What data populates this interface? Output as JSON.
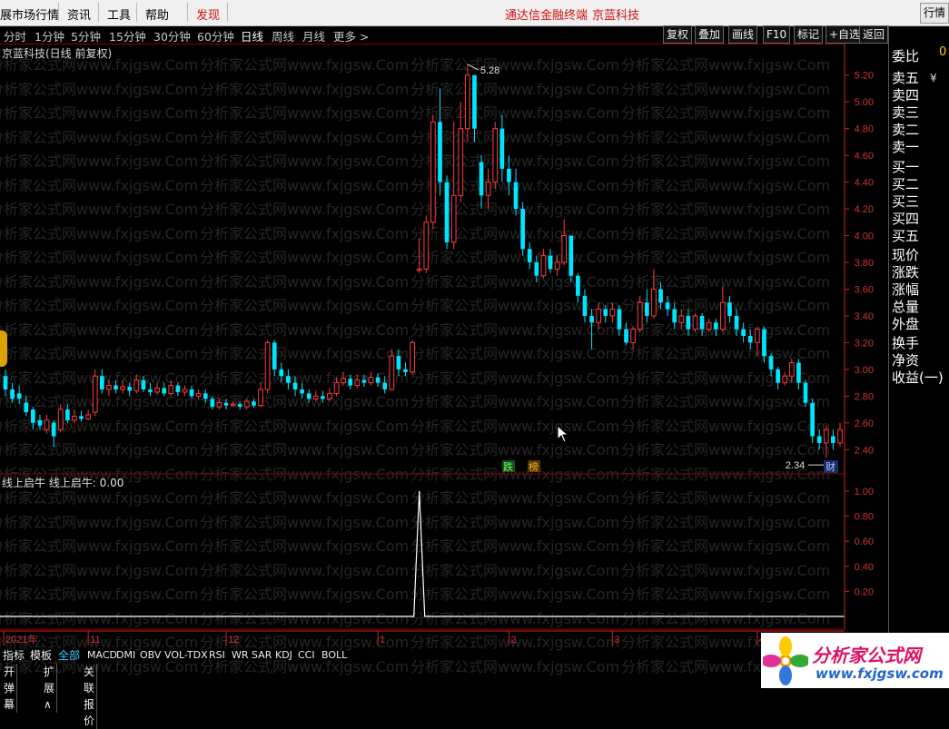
{
  "menubar": {
    "items": [
      "展市场行情",
      "资讯",
      "工具",
      "帮助",
      "发现"
    ],
    "center_title": "通达信金融终端",
    "stock_name": "京蓝科技",
    "right_button": "行情"
  },
  "toolbar": {
    "periods": [
      "分时",
      "1分钟",
      "5分钟",
      "15分钟",
      "30分钟",
      "60分钟",
      "日线",
      "周线",
      "月线",
      "更多 >"
    ],
    "active_period": "日线",
    "buttons": [
      "复权",
      "叠加",
      "画线",
      "F10",
      "标记",
      "+自选",
      "返回"
    ]
  },
  "main_chart": {
    "title": "京蓝科技(日线 前复权)",
    "high_label": "5.28",
    "low_label": "2.34",
    "y_ticks": [
      "5.20",
      "5.00",
      "4.80",
      "4.60",
      "4.40",
      "4.20",
      "4.00",
      "3.80",
      "3.60",
      "3.40",
      "3.20",
      "3.00",
      "2.80",
      "2.60",
      "2.40"
    ],
    "badges": [
      "跌",
      "榜"
    ],
    "fin_badge": "财"
  },
  "indicator": {
    "title": "线上启牛  线上启牛: 0.00",
    "y_ticks": [
      "1.00",
      "0.80",
      "0.60",
      "0.40",
      "0.20"
    ]
  },
  "time_axis": {
    "labels": [
      "2021年",
      "11",
      "12",
      "1",
      "2",
      "3",
      "4"
    ]
  },
  "right_panel": {
    "labels": [
      "委比",
      "卖五",
      "卖四",
      "卖三",
      "卖二",
      "卖一",
      "买一",
      "买二",
      "买三",
      "买四",
      "买五",
      "现价",
      "涨跌",
      "涨幅",
      "总量",
      "外盘",
      "换手",
      "净资",
      "收益(一)"
    ],
    "top_value": "0",
    "currency": "¥"
  },
  "bottom": {
    "tabs": [
      "指标",
      "模板",
      "全部",
      "MACD",
      "DMI",
      "OBV",
      "VOL-TDX",
      "RSI",
      "WR",
      "SAR",
      "KDJ",
      "CCI",
      "BOLL"
    ],
    "active_tab": "全部",
    "row2": [
      "开弹幕",
      "扩展∧",
      "关联报价"
    ]
  },
  "watermark": "分析家公式网www.fxjgsw.Com",
  "logo": {
    "text": "分析家公式网",
    "url": "www.fxjgsw.com"
  },
  "colors": {
    "up": "#ff3b3b",
    "down": "#00e5ff",
    "grid": "#8b0000",
    "axis": "#cc2222"
  },
  "chart_data": {
    "type": "candlestick",
    "title": "京蓝科技(日线 前复权)",
    "y_range": [
      2.3,
      5.3
    ],
    "candles": [
      {
        "o": 2.95,
        "c": 2.85,
        "h": 3.0,
        "l": 2.8
      },
      {
        "o": 2.85,
        "c": 2.78,
        "h": 2.9,
        "l": 2.75
      },
      {
        "o": 2.82,
        "c": 2.78,
        "h": 2.88,
        "l": 2.74
      },
      {
        "o": 2.75,
        "c": 2.68,
        "h": 2.8,
        "l": 2.65
      },
      {
        "o": 2.7,
        "c": 2.6,
        "h": 2.72,
        "l": 2.55
      },
      {
        "o": 2.62,
        "c": 2.58,
        "h": 2.66,
        "l": 2.55
      },
      {
        "o": 2.55,
        "c": 2.62,
        "h": 2.66,
        "l": 2.52
      },
      {
        "o": 2.6,
        "c": 2.5,
        "h": 2.62,
        "l": 2.42
      },
      {
        "o": 2.55,
        "c": 2.7,
        "h": 2.74,
        "l": 2.53
      },
      {
        "o": 2.7,
        "c": 2.62,
        "h": 2.74,
        "l": 2.6
      },
      {
        "o": 2.62,
        "c": 2.65,
        "h": 2.7,
        "l": 2.6
      },
      {
        "o": 2.65,
        "c": 2.63,
        "h": 2.69,
        "l": 2.61
      },
      {
        "o": 2.63,
        "c": 2.66,
        "h": 2.7,
        "l": 2.62
      },
      {
        "o": 2.68,
        "c": 2.95,
        "h": 3.0,
        "l": 2.65
      },
      {
        "o": 2.95,
        "c": 2.85,
        "h": 3.0,
        "l": 2.82
      },
      {
        "o": 2.85,
        "c": 2.88,
        "h": 2.92,
        "l": 2.8
      },
      {
        "o": 2.88,
        "c": 2.85,
        "h": 2.92,
        "l": 2.82
      },
      {
        "o": 2.85,
        "c": 2.87,
        "h": 2.92,
        "l": 2.82
      },
      {
        "o": 2.87,
        "c": 2.84,
        "h": 2.9,
        "l": 2.8
      },
      {
        "o": 2.84,
        "c": 2.92,
        "h": 2.96,
        "l": 2.82
      },
      {
        "o": 2.92,
        "c": 2.85,
        "h": 2.95,
        "l": 2.83
      },
      {
        "o": 2.85,
        "c": 2.83,
        "h": 2.9,
        "l": 2.8
      },
      {
        "o": 2.83,
        "c": 2.86,
        "h": 2.9,
        "l": 2.81
      },
      {
        "o": 2.86,
        "c": 2.82,
        "h": 2.9,
        "l": 2.8
      },
      {
        "o": 2.82,
        "c": 2.88,
        "h": 2.92,
        "l": 2.8
      },
      {
        "o": 2.88,
        "c": 2.83,
        "h": 2.9,
        "l": 2.8
      },
      {
        "o": 2.83,
        "c": 2.85,
        "h": 2.88,
        "l": 2.8
      },
      {
        "o": 2.85,
        "c": 2.8,
        "h": 2.88,
        "l": 2.78
      },
      {
        "o": 2.8,
        "c": 2.82,
        "h": 2.85,
        "l": 2.77
      },
      {
        "o": 2.82,
        "c": 2.78,
        "h": 2.85,
        "l": 2.75
      },
      {
        "o": 2.78,
        "c": 2.72,
        "h": 2.8,
        "l": 2.7
      },
      {
        "o": 2.72,
        "c": 2.75,
        "h": 2.78,
        "l": 2.7
      },
      {
        "o": 2.75,
        "c": 2.73,
        "h": 2.78,
        "l": 2.7
      },
      {
        "o": 2.73,
        "c": 2.74,
        "h": 2.76,
        "l": 2.72
      },
      {
        "o": 2.74,
        "c": 2.72,
        "h": 2.76,
        "l": 2.7
      },
      {
        "o": 2.72,
        "c": 2.76,
        "h": 2.78,
        "l": 2.7
      },
      {
        "o": 2.76,
        "c": 2.73,
        "h": 2.78,
        "l": 2.71
      },
      {
        "o": 2.73,
        "c": 2.85,
        "h": 2.9,
        "l": 2.72
      },
      {
        "o": 2.85,
        "c": 3.2,
        "h": 3.22,
        "l": 2.82
      },
      {
        "o": 3.2,
        "c": 3.0,
        "h": 3.22,
        "l": 2.95
      },
      {
        "o": 3.0,
        "c": 2.95,
        "h": 3.05,
        "l": 2.9
      },
      {
        "o": 2.95,
        "c": 2.9,
        "h": 3.0,
        "l": 2.85
      },
      {
        "o": 2.9,
        "c": 2.85,
        "h": 2.95,
        "l": 2.8
      },
      {
        "o": 2.85,
        "c": 2.82,
        "h": 2.9,
        "l": 2.78
      },
      {
        "o": 2.82,
        "c": 2.78,
        "h": 2.85,
        "l": 2.75
      },
      {
        "o": 2.78,
        "c": 2.8,
        "h": 2.84,
        "l": 2.76
      },
      {
        "o": 2.8,
        "c": 2.78,
        "h": 2.84,
        "l": 2.75
      },
      {
        "o": 2.78,
        "c": 2.82,
        "h": 2.86,
        "l": 2.76
      },
      {
        "o": 2.82,
        "c": 2.9,
        "h": 2.94,
        "l": 2.8
      },
      {
        "o": 2.9,
        "c": 2.93,
        "h": 2.98,
        "l": 2.88
      },
      {
        "o": 2.93,
        "c": 2.88,
        "h": 2.96,
        "l": 2.85
      },
      {
        "o": 2.88,
        "c": 2.92,
        "h": 2.96,
        "l": 2.86
      },
      {
        "o": 2.92,
        "c": 2.9,
        "h": 2.96,
        "l": 2.87
      },
      {
        "o": 2.9,
        "c": 2.94,
        "h": 2.98,
        "l": 2.88
      },
      {
        "o": 2.94,
        "c": 2.9,
        "h": 2.97,
        "l": 2.87
      },
      {
        "o": 2.9,
        "c": 2.85,
        "h": 2.95,
        "l": 2.82
      },
      {
        "o": 2.85,
        "c": 3.1,
        "h": 3.15,
        "l": 2.84
      },
      {
        "o": 3.1,
        "c": 3.0,
        "h": 3.15,
        "l": 2.95
      },
      {
        "o": 3.0,
        "c": 2.98,
        "h": 3.05,
        "l": 2.95
      },
      {
        "o": 2.98,
        "c": 3.2,
        "h": 3.22,
        "l": 2.96
      },
      {
        "o": 3.74,
        "c": 3.75,
        "h": 3.98,
        "l": 3.72
      },
      {
        "o": 3.75,
        "c": 4.1,
        "h": 4.15,
        "l": 3.72
      },
      {
        "o": 4.1,
        "c": 4.85,
        "h": 4.9,
        "l": 4.05
      },
      {
        "o": 4.85,
        "c": 4.4,
        "h": 5.1,
        "l": 4.3
      },
      {
        "o": 4.4,
        "c": 3.95,
        "h": 4.45,
        "l": 3.9
      },
      {
        "o": 3.95,
        "c": 4.3,
        "h": 4.85,
        "l": 3.9
      },
      {
        "o": 4.3,
        "c": 4.8,
        "h": 5.0,
        "l": 4.25
      },
      {
        "o": 4.8,
        "c": 5.2,
        "h": 5.28,
        "l": 4.7
      },
      {
        "o": 5.2,
        "c": 4.8,
        "h": 5.1,
        "l": 4.7
      },
      {
        "o": 4.55,
        "c": 4.3,
        "h": 4.6,
        "l": 4.2
      },
      {
        "o": 4.3,
        "c": 4.4,
        "h": 4.5,
        "l": 4.2
      },
      {
        "o": 4.4,
        "c": 4.8,
        "h": 4.85,
        "l": 4.35
      },
      {
        "o": 4.8,
        "c": 4.5,
        "h": 4.9,
        "l": 4.4
      },
      {
        "o": 4.5,
        "c": 4.4,
        "h": 4.6,
        "l": 4.3
      },
      {
        "o": 4.4,
        "c": 4.2,
        "h": 4.5,
        "l": 4.15
      },
      {
        "o": 4.2,
        "c": 3.9,
        "h": 4.25,
        "l": 3.85
      },
      {
        "o": 3.9,
        "c": 3.8,
        "h": 3.95,
        "l": 3.75
      },
      {
        "o": 3.8,
        "c": 3.7,
        "h": 3.85,
        "l": 3.65
      },
      {
        "o": 3.7,
        "c": 3.85,
        "h": 3.9,
        "l": 3.68
      },
      {
        "o": 3.85,
        "c": 3.75,
        "h": 3.9,
        "l": 3.72
      },
      {
        "o": 3.75,
        "c": 3.8,
        "h": 3.85,
        "l": 3.7
      },
      {
        "o": 3.8,
        "c": 4.0,
        "h": 4.12,
        "l": 3.78
      },
      {
        "o": 4.0,
        "c": 3.7,
        "h": 4.0,
        "l": 3.65
      },
      {
        "o": 3.7,
        "c": 3.55,
        "h": 3.72,
        "l": 3.5
      },
      {
        "o": 3.55,
        "c": 3.4,
        "h": 3.6,
        "l": 3.35
      },
      {
        "o": 3.4,
        "c": 3.35,
        "h": 3.45,
        "l": 3.15
      },
      {
        "o": 3.35,
        "c": 3.45,
        "h": 3.5,
        "l": 3.3
      },
      {
        "o": 3.45,
        "c": 3.4,
        "h": 3.48,
        "l": 3.35
      },
      {
        "o": 3.4,
        "c": 3.45,
        "h": 3.5,
        "l": 3.35
      },
      {
        "o": 3.45,
        "c": 3.3,
        "h": 3.48,
        "l": 3.25
      },
      {
        "o": 3.3,
        "c": 3.2,
        "h": 3.35,
        "l": 3.18
      },
      {
        "o": 3.2,
        "c": 3.3,
        "h": 3.32,
        "l": 3.15
      },
      {
        "o": 3.3,
        "c": 3.5,
        "h": 3.55,
        "l": 3.28
      },
      {
        "o": 3.5,
        "c": 3.4,
        "h": 3.6,
        "l": 3.35
      },
      {
        "o": 3.4,
        "c": 3.6,
        "h": 3.75,
        "l": 3.38
      },
      {
        "o": 3.6,
        "c": 3.5,
        "h": 3.65,
        "l": 3.45
      },
      {
        "o": 3.5,
        "c": 3.45,
        "h": 3.55,
        "l": 3.4
      },
      {
        "o": 3.45,
        "c": 3.35,
        "h": 3.5,
        "l": 3.3
      },
      {
        "o": 3.35,
        "c": 3.4,
        "h": 3.45,
        "l": 3.3
      },
      {
        "o": 3.4,
        "c": 3.3,
        "h": 3.45,
        "l": 3.25
      },
      {
        "o": 3.3,
        "c": 3.4,
        "h": 3.42,
        "l": 3.28
      },
      {
        "o": 3.4,
        "c": 3.3,
        "h": 3.42,
        "l": 3.25
      },
      {
        "o": 3.3,
        "c": 3.35,
        "h": 3.38,
        "l": 3.28
      },
      {
        "o": 3.35,
        "c": 3.3,
        "h": 3.38,
        "l": 3.25
      },
      {
        "o": 3.3,
        "c": 3.5,
        "h": 3.62,
        "l": 3.28
      },
      {
        "o": 3.5,
        "c": 3.4,
        "h": 3.55,
        "l": 3.35
      },
      {
        "o": 3.4,
        "c": 3.3,
        "h": 3.45,
        "l": 3.25
      },
      {
        "o": 3.3,
        "c": 3.25,
        "h": 3.35,
        "l": 3.2
      },
      {
        "o": 3.25,
        "c": 3.2,
        "h": 3.3,
        "l": 3.15
      },
      {
        "o": 3.2,
        "c": 3.3,
        "h": 3.32,
        "l": 3.1
      },
      {
        "o": 3.3,
        "c": 3.1,
        "h": 3.32,
        "l": 3.05
      },
      {
        "o": 3.1,
        "c": 3.0,
        "h": 3.12,
        "l": 2.95
      },
      {
        "o": 3.0,
        "c": 2.9,
        "h": 3.02,
        "l": 2.85
      },
      {
        "o": 2.9,
        "c": 2.95,
        "h": 2.98,
        "l": 2.88
      },
      {
        "o": 2.95,
        "c": 3.05,
        "h": 3.08,
        "l": 2.9
      },
      {
        "o": 3.05,
        "c": 2.9,
        "h": 3.08,
        "l": 2.85
      },
      {
        "o": 2.9,
        "c": 2.75,
        "h": 2.92,
        "l": 2.72
      },
      {
        "o": 2.75,
        "c": 2.5,
        "h": 2.78,
        "l": 2.45
      },
      {
        "o": 2.5,
        "c": 2.45,
        "h": 2.55,
        "l": 2.4
      },
      {
        "o": 2.45,
        "c": 2.55,
        "h": 2.58,
        "l": 2.34
      },
      {
        "o": 2.5,
        "c": 2.45,
        "h": 2.55,
        "l": 2.4
      },
      {
        "o": 2.45,
        "c": 2.55,
        "h": 2.6,
        "l": 2.42
      }
    ],
    "indicator": {
      "name": "线上启牛",
      "peak_index": 60,
      "peak_value": 1.0,
      "y_range": [
        0,
        1.05
      ]
    }
  }
}
